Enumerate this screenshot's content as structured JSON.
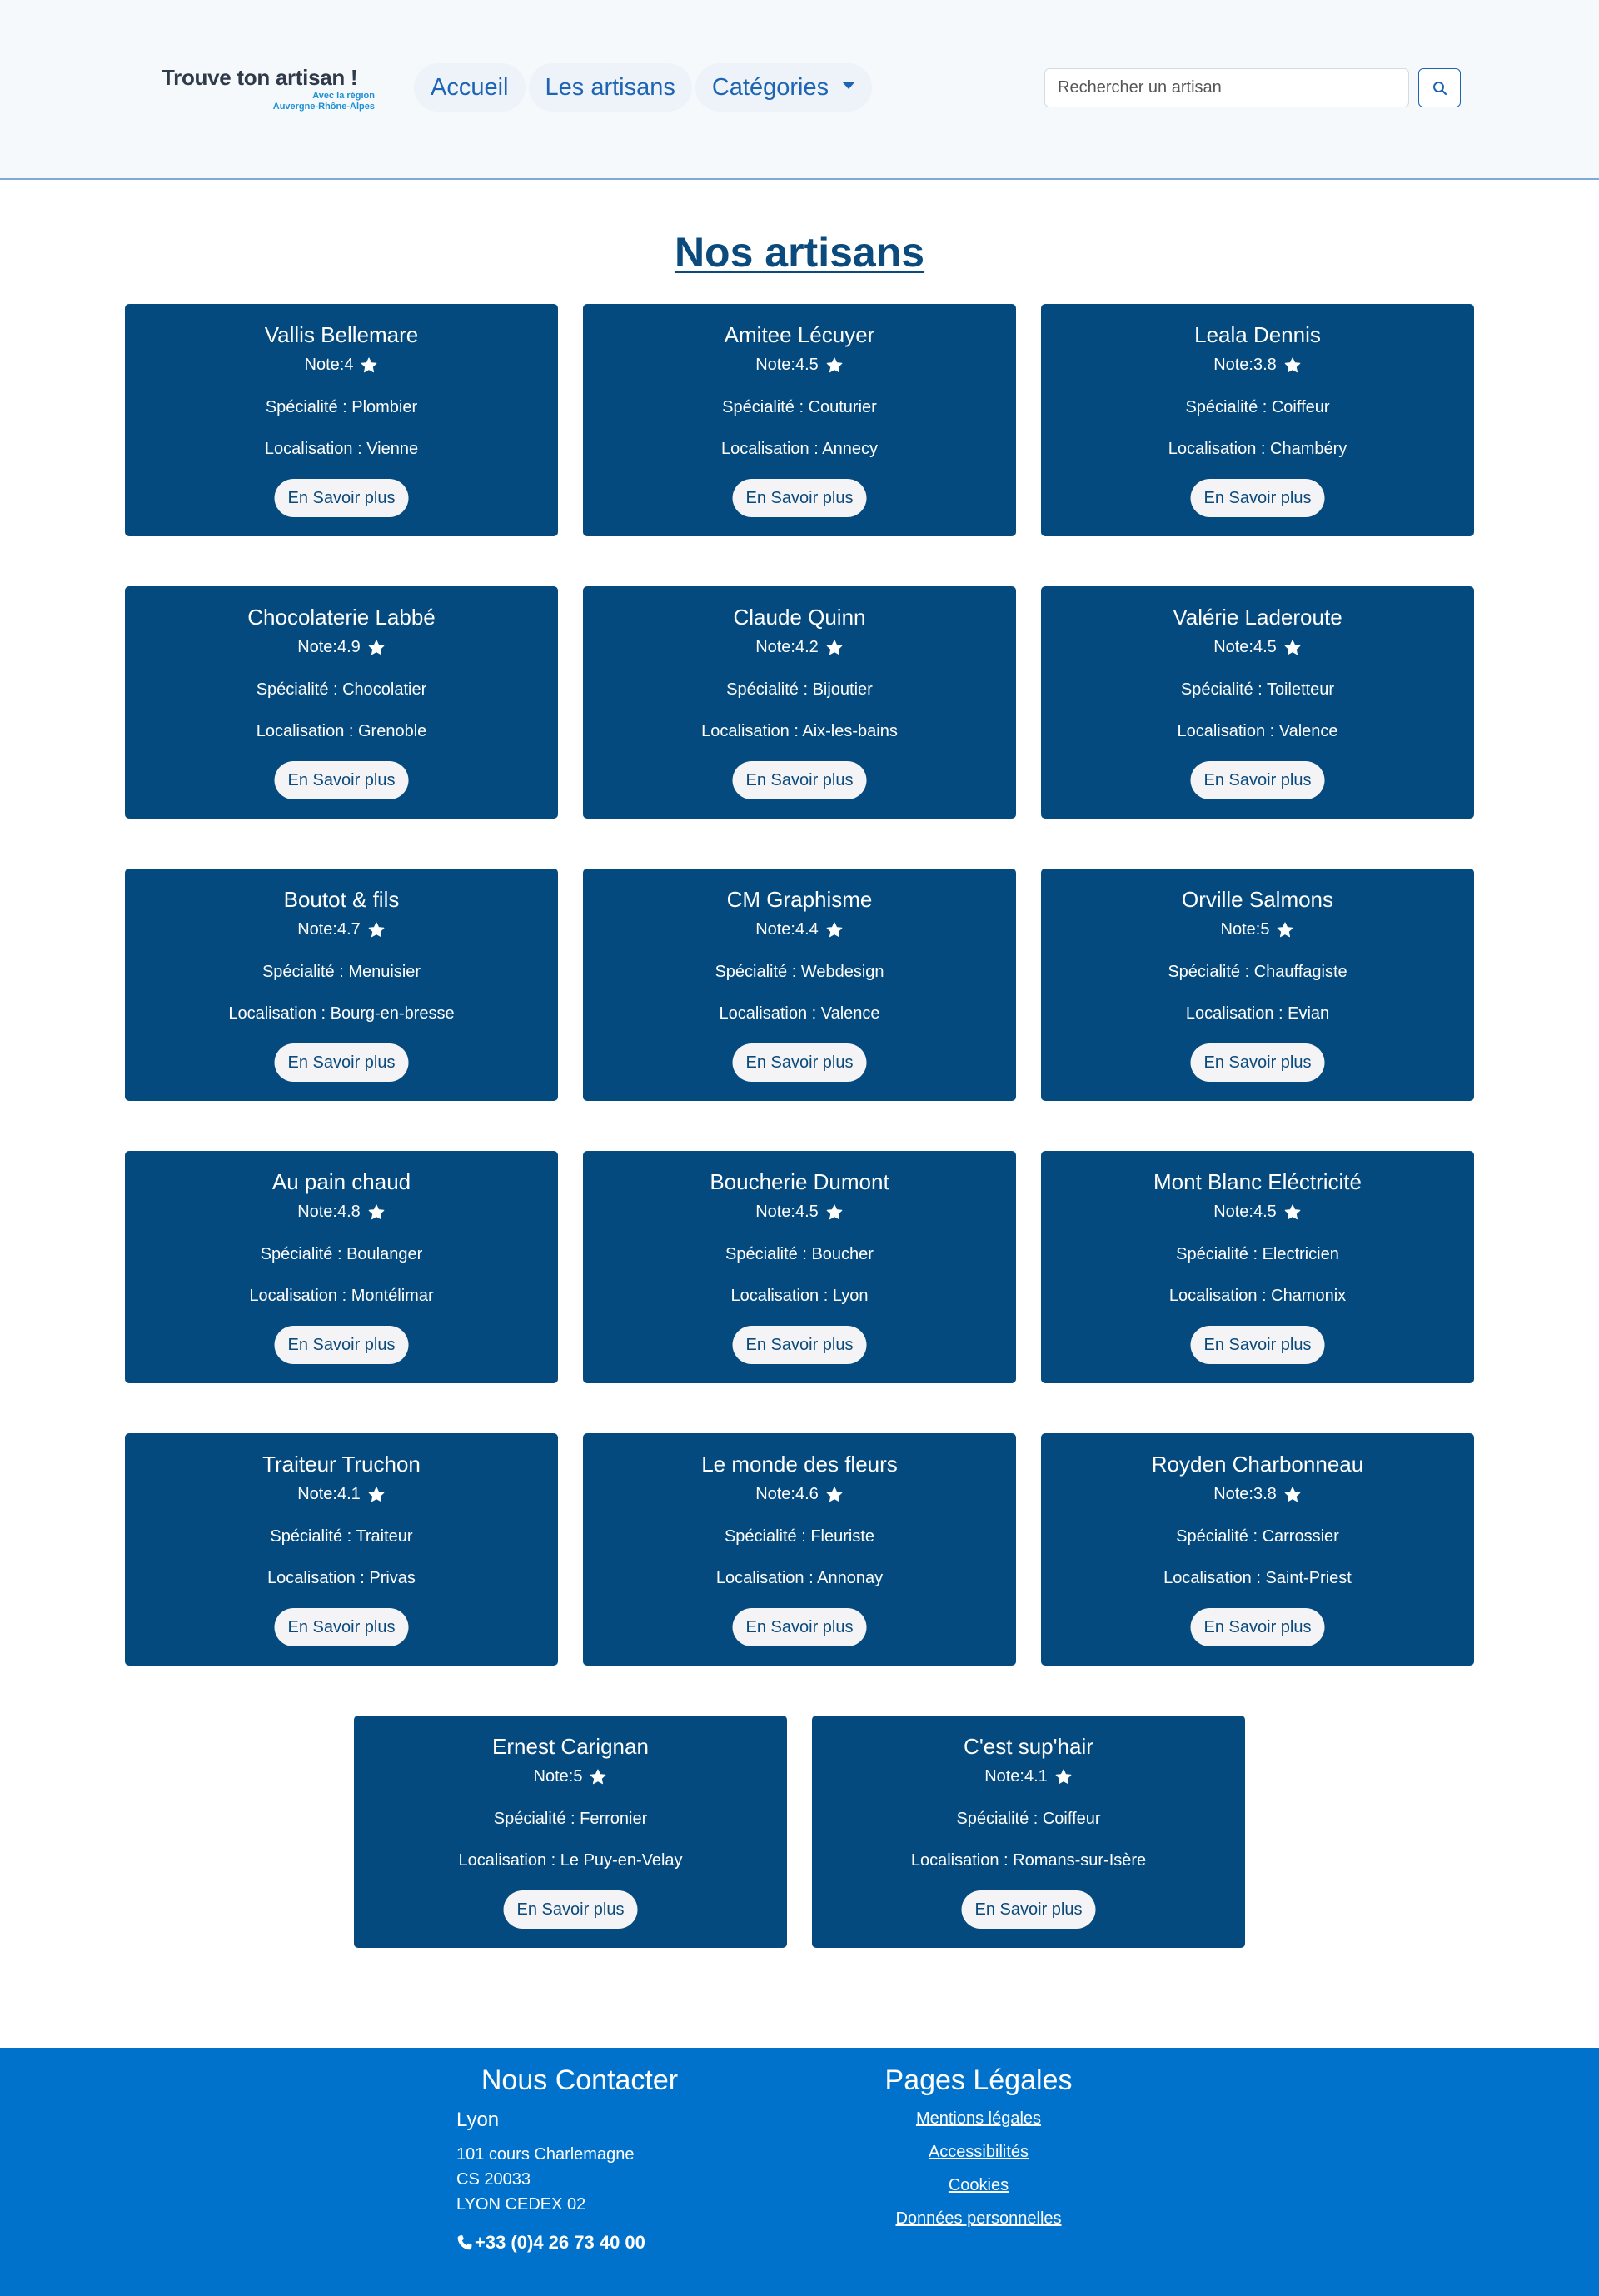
{
  "header": {
    "logo_title": "Trouve ton artisan !",
    "logo_sub1": "Avec la région",
    "logo_sub2": "Auvergne-Rhône-Alpes",
    "nav": [
      {
        "label": "Accueil"
      },
      {
        "label": "Les artisans"
      },
      {
        "label": "Catégories"
      }
    ],
    "search_placeholder": "Rechercher un artisan",
    "search_icon": "magnifier-icon"
  },
  "page_title": "Nos artisans",
  "card_labels": {
    "note_prefix": "Note: ",
    "spec_prefix": "Spécialité : ",
    "loc_prefix": "Localisation : ",
    "button": "En Savoir plus",
    "star_icon": "star-icon"
  },
  "artisans": [
    {
      "name": "Vallis Bellemare",
      "note": "4",
      "specialty": "Plombier",
      "location": "Vienne"
    },
    {
      "name": "Amitee Lécuyer",
      "note": "4.5",
      "specialty": "Couturier",
      "location": "Annecy"
    },
    {
      "name": "Leala Dennis",
      "note": "3.8",
      "specialty": "Coiffeur",
      "location": "Chambéry"
    },
    {
      "name": "Chocolaterie Labbé",
      "note": "4.9",
      "specialty": "Chocolatier",
      "location": "Grenoble"
    },
    {
      "name": "Claude Quinn",
      "note": "4.2",
      "specialty": "Bijoutier",
      "location": "Aix-les-bains"
    },
    {
      "name": "Valérie Laderoute",
      "note": "4.5",
      "specialty": "Toiletteur",
      "location": "Valence"
    },
    {
      "name": "Boutot & fils",
      "note": "4.7",
      "specialty": "Menuisier",
      "location": "Bourg-en-bresse"
    },
    {
      "name": "CM Graphisme",
      "note": "4.4",
      "specialty": "Webdesign",
      "location": "Valence"
    },
    {
      "name": "Orville Salmons",
      "note": "5",
      "specialty": "Chauffagiste",
      "location": "Evian"
    },
    {
      "name": "Au pain chaud",
      "note": "4.8",
      "specialty": "Boulanger",
      "location": "Montélimar"
    },
    {
      "name": "Boucherie Dumont",
      "note": "4.5",
      "specialty": "Boucher",
      "location": "Lyon"
    },
    {
      "name": "Mont Blanc Eléctricité",
      "note": "4.5",
      "specialty": "Electricien",
      "location": "Chamonix"
    },
    {
      "name": "Traiteur Truchon",
      "note": "4.1",
      "specialty": "Traiteur",
      "location": "Privas"
    },
    {
      "name": "Le monde des fleurs",
      "note": "4.6",
      "specialty": "Fleuriste",
      "location": "Annonay"
    },
    {
      "name": "Royden Charbonneau",
      "note": "3.8",
      "specialty": "Carrossier",
      "location": "Saint-Priest"
    },
    {
      "name": "Ernest Carignan",
      "note": "5",
      "specialty": "Ferronier",
      "location": "Le Puy-en-Velay"
    },
    {
      "name": "C'est sup'hair",
      "note": "4.1",
      "specialty": "Coiffeur",
      "location": "Romans-sur-Isère"
    }
  ],
  "footer": {
    "contact_title": "Nous Contacter",
    "city": "Lyon",
    "address": [
      "101 cours Charlemagne",
      "CS 20033",
      "LYON CEDEX 02"
    ],
    "phone": "+33 (0)4 26 73 40 00",
    "phone_icon": "phone-icon",
    "legal_title": "Pages Légales",
    "legal_links": [
      "Mentions légales",
      "Accessibilités",
      "Cookies",
      "Données personnelles"
    ]
  },
  "colors": {
    "card_bg": "#044a7e",
    "footer_bg": "#0172cb",
    "link_blue": "#1e64b4",
    "title_blue": "#0b4a7c"
  }
}
